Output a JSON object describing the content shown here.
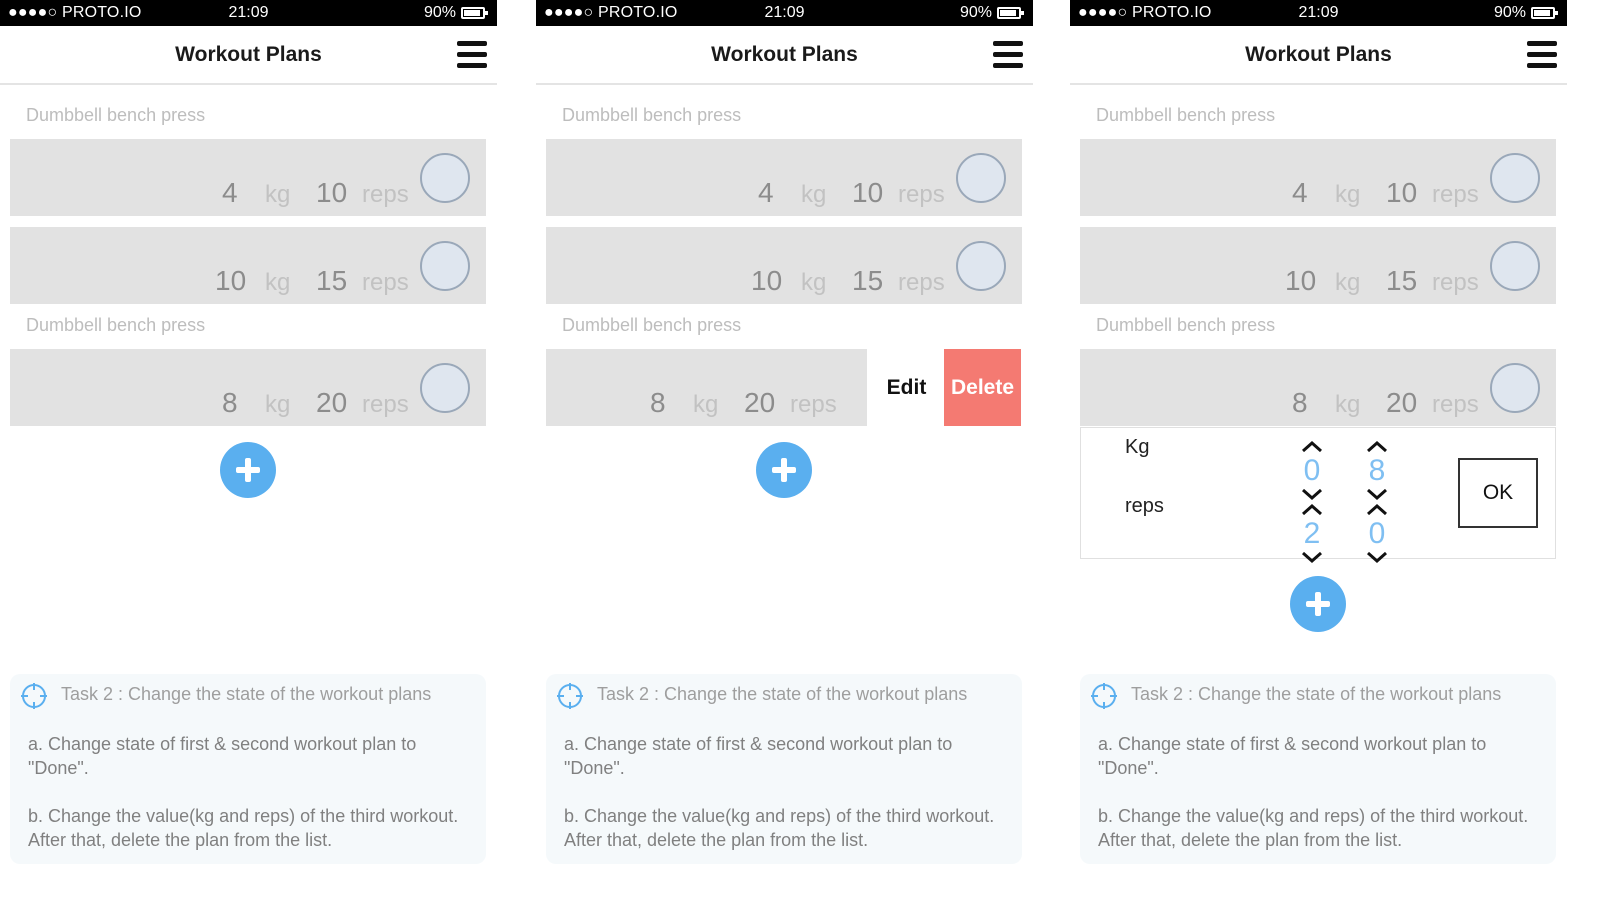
{
  "status": {
    "carrier": "●●●●○ PROTO.IO",
    "time": "21:09",
    "battery": "90%"
  },
  "header": {
    "title": "Workout Plans",
    "menu_icon": "hamburger-menu-icon"
  },
  "plans": {
    "section1": "Dumbbell bench press",
    "section2": "Dumbbell bench press",
    "rows": [
      {
        "kg": "4",
        "reps": "10"
      },
      {
        "kg": "10",
        "reps": "15"
      },
      {
        "kg": "8",
        "reps": "20"
      }
    ],
    "unit_kg": "kg",
    "unit_reps": "reps"
  },
  "swipe_actions": {
    "edit": "Edit",
    "delete": "Delete"
  },
  "editor": {
    "kg_label": "Kg",
    "reps_label": "reps",
    "kg_digits": [
      "0",
      "8"
    ],
    "reps_digits": [
      "2",
      "0"
    ],
    "ok": "OK"
  },
  "task": {
    "title": "Task 2 : Change the state of the workout plans",
    "a": "a. Change state of first & second workout plan to \"Done\".",
    "b": "b. Change the value(kg and reps) of the third workout. After that, delete the plan from the list."
  },
  "colors": {
    "accent": "#5aafef",
    "delete": "#f47a72",
    "row_bg": "#e2e2e2"
  }
}
